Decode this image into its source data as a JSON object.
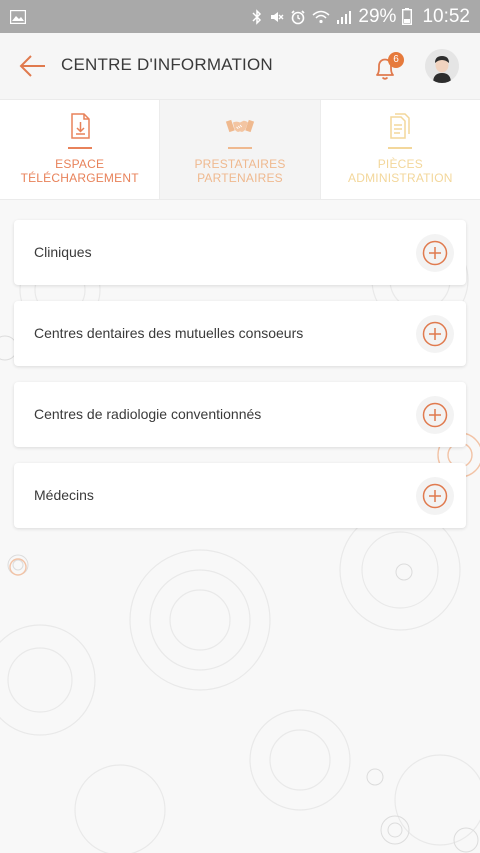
{
  "status_bar": {
    "battery": "29%",
    "time": "10:52",
    "icons": [
      "gallery-icon",
      "bluetooth-icon",
      "mute-icon",
      "alarm-icon",
      "wifi-icon",
      "signal-icon",
      "battery-icon"
    ]
  },
  "header": {
    "title": "CENTRE D'INFORMATION",
    "notification_count": "6",
    "icons": [
      "back-arrow-icon",
      "bell-icon",
      "avatar-icon"
    ]
  },
  "tabs": [
    {
      "label": "ESPACE\nTÉLÉCHARGEMENT",
      "icon": "download-document-icon",
      "color": "#e8825a"
    },
    {
      "label": "PRESTATAIRES\nPARTENAIRES",
      "icon": "handshake-icon",
      "color": "#efb98f",
      "active": true
    },
    {
      "label": "PIÈCES\nADMINISTRATION",
      "icon": "documents-icon",
      "color": "#f3d79b"
    }
  ],
  "list": {
    "items": [
      {
        "label": "Cliniques"
      },
      {
        "label": "Centres dentaires des mutuelles consoeurs"
      },
      {
        "label": "Centres de radiologie conventionnés"
      },
      {
        "label": "Médecins"
      }
    ],
    "action_icon": "plus-circle-icon"
  },
  "colors": {
    "accent": "#e07a4e",
    "status_bar": "#a9a9a9",
    "background": "#f8f8f8"
  }
}
